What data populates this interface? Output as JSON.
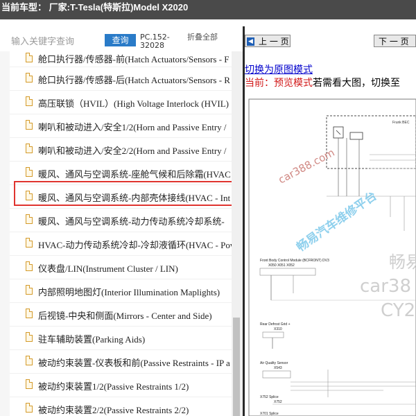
{
  "header": {
    "title": "当前车型：  厂家:T-Tesla(特斯拉)Model X2020"
  },
  "search": {
    "placeholder": "输入关键字查询",
    "button_label": "查询",
    "pc_number": "PC.152-32028",
    "collapse_label": "折叠全部"
  },
  "tree": {
    "items": [
      {
        "label": "舱口执行器/传感器-前(Hatch Actuators/Sensors - F"
      },
      {
        "label": "舱口执行器/传感器-后(Hatch Actuators/Sensors - R"
      },
      {
        "label": "高压联锁（HVIL）(High Voltage Interlock (HVIL)"
      },
      {
        "label": "喇叭和被动进入/安全1/2(Horn and Passive Entry /"
      },
      {
        "label": "喇叭和被动进入/安全2/2(Horn and Passive Entry /"
      },
      {
        "label": "暖风、通风与空调系统-座舱气候和后除霜(HVAC"
      },
      {
        "label": "暖风、通风与空调系统-内部壳体接线(HVAC - Int"
      },
      {
        "label": "暖风、通风与空调系统-动力传动系统冷却系统-"
      },
      {
        "label": "HVAC-动力传动系统冷却-冷却液循环(HVAC - Pow"
      },
      {
        "label": "仪表盘/LIN(Instrument Cluster / LIN)"
      },
      {
        "label": "内部照明地图灯(Interior Illumination Maplights)"
      },
      {
        "label": "后视镜-中央和侧面(Mirrors - Center and Side)"
      },
      {
        "label": "驻车辅助装置(Parking Aids)"
      },
      {
        "label": "被动约束装置-仪表板和前(Passive Restraints - IP a"
      },
      {
        "label": "被动约束装置1/2(Passive Restraints 1/2)"
      },
      {
        "label": "被动约束装置2/2(Passive Restraints 2/2)"
      }
    ]
  },
  "viewer": {
    "prev_label": "上 一 页",
    "next_label": "下 一 页",
    "switch_link": "切换为原图模式",
    "status_prefix": "当前：预览模式",
    "status_suffix": "若需看大图，切换至"
  },
  "diagram": {
    "title_right": "Frunk BEC",
    "module1": "Front Body Control Module (BCFRONT) DV3",
    "module1_pins": "X050 X051 X052",
    "rear_defrost": "Rear Defrost Grid +",
    "rear_defrost_conn": "X310",
    "aq_sensor": "Air Quality Sensor",
    "aq_conn": "X543",
    "splice1": "X752 Splice",
    "splice1_conn": "X752",
    "splice2": "X701 Splice",
    "watermark1": "car388.com",
    "watermark2": "畅易汽车维修平台",
    "watermark3_line1": "畅易",
    "watermark3_line2": "car38",
    "watermark3_line3": "CY2"
  },
  "colors": {
    "header_bg": "#4a4a4a",
    "search_button": "#2a7bc8",
    "highlight_border": "#e0342f",
    "link": "#0000cc",
    "status_red": "#d21a1a",
    "file_icon": "#d49a2a"
  }
}
